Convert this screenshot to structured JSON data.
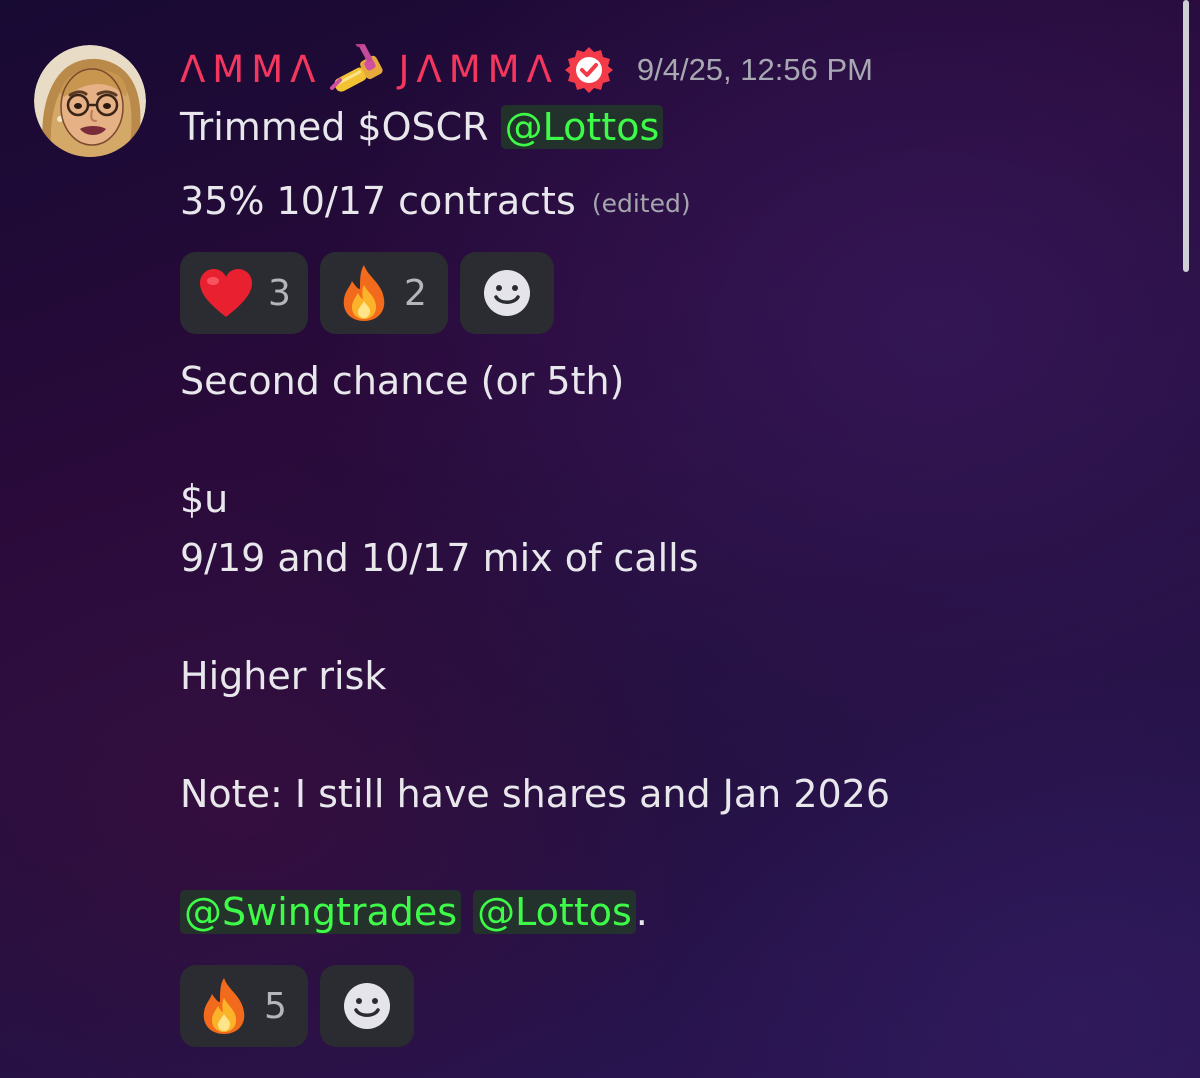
{
  "message": {
    "author": {
      "name_left": "ΛMMΛ",
      "name_right": "JΛMMΛ",
      "nail_icon": "nail-polish-emoji-icon",
      "verified_icon": "verified-badge-icon",
      "avatar_icon": "cartoon-avatar-icon"
    },
    "timestamp": "9/4/25, 12:56 PM",
    "lines": {
      "l1_text": "Trimmed $OSCR ",
      "l1_mention": "@Lottos",
      "l2_text": "35% 10/17 contracts",
      "l2_edited": "(edited)"
    },
    "reactions_first": [
      {
        "emoji": "heart-emoji-icon",
        "count": "3"
      },
      {
        "emoji": "fire-emoji-icon",
        "count": "2"
      },
      {
        "emoji": "add-reaction-icon"
      }
    ],
    "body": {
      "second_chance": "Second chance (or 5th)",
      "ticker": "$u",
      "mix": "9/19 and 10/17 mix of calls",
      "risk": "Higher risk",
      "note": "Note: I still have shares and Jan 2026",
      "mention_swing": "@Swingtrades",
      "mention_lottos": "@Lottos",
      "tail": "."
    },
    "reactions_second": [
      {
        "emoji": "fire-emoji-icon",
        "count": "5"
      },
      {
        "emoji": "add-reaction-icon"
      }
    ]
  },
  "colors": {
    "username": "#f5365f",
    "mention_text": "#3dfb48",
    "mention_bg": "#223c26",
    "reaction_bg": "#2a2c31",
    "timestamp": "#a7a8b2"
  }
}
